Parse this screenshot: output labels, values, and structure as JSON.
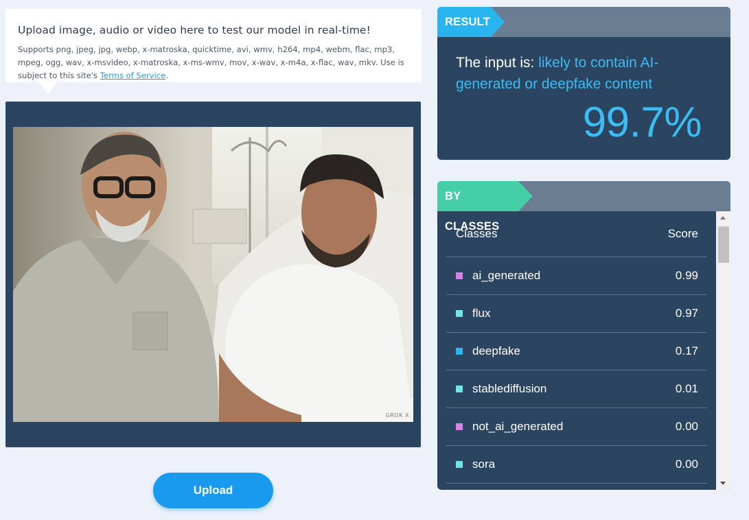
{
  "upload": {
    "title": "Upload image, audio or video here to test our model in real-time!",
    "supports_text": "Supports png, jpeg, jpg, webp, x-matroska, quicktime, avi, wmv, h264, mp4, webm, flac, mp3, mpeg, ogg, wav, x-msvideo, x-matroska, x-ms-wmv, mov, x-wav, x-m4a, x-flac, wav, mkv. Use is subject to this site's ",
    "terms_link": "Terms of Service",
    "terms_suffix": ".",
    "button_label": "Upload"
  },
  "preview": {
    "watermark": "GROK X"
  },
  "result": {
    "tag": "RESULT",
    "prefix": "The input is: ",
    "verdict": "likely to contain AI-generated or deepfake content",
    "percent": "99.7%"
  },
  "classes": {
    "tag": "BY CLASSES",
    "header_classes": "Classes",
    "header_score": "Score",
    "rows": [
      {
        "name": "ai_generated",
        "score": "0.99",
        "color": "#d783e6"
      },
      {
        "name": "flux",
        "score": "0.97",
        "color": "#6fe6e6"
      },
      {
        "name": "deepfake",
        "score": "0.17",
        "color": "#2eb4ef"
      },
      {
        "name": "stablediffusion",
        "score": "0.01",
        "color": "#6fe6e6"
      },
      {
        "name": "not_ai_generated",
        "score": "0.00",
        "color": "#d783e6"
      },
      {
        "name": "sora",
        "score": "0.00",
        "color": "#6fe6e6"
      }
    ]
  },
  "colors": {
    "accent_blue": "#3cbcf3",
    "result_tag": "#2ab4ee",
    "classes_tag": "#45cfa6",
    "panel_bg": "#2b4560",
    "button_bg": "#1a9aee"
  }
}
